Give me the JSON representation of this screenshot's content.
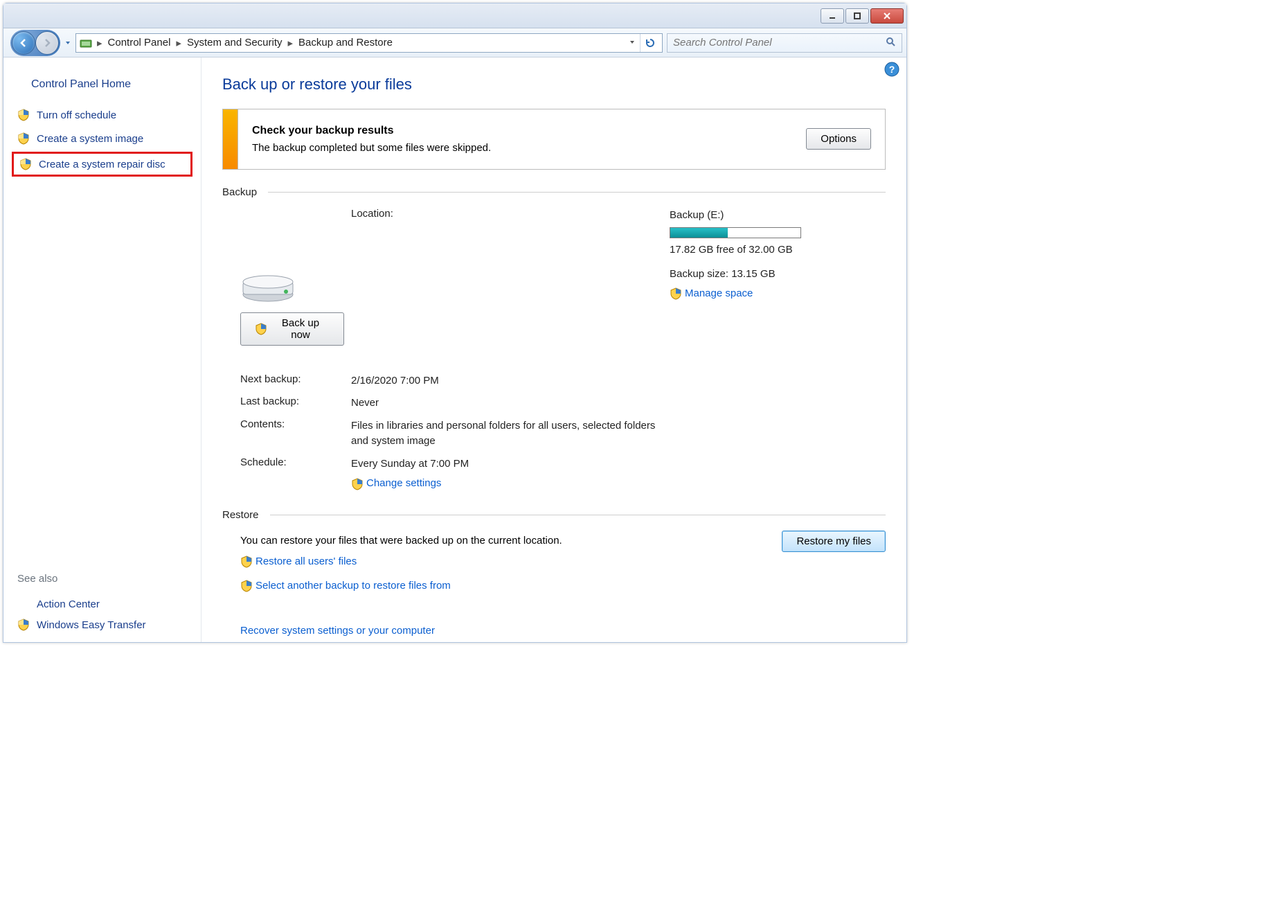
{
  "titlebar": {
    "minimize_label": "Minimize",
    "maximize_label": "Maximize",
    "close_label": "Close"
  },
  "breadcrumbs": {
    "items": [
      "Control Panel",
      "System and Security",
      "Backup and Restore"
    ]
  },
  "search": {
    "placeholder": "Search Control Panel"
  },
  "sidebar": {
    "home": "Control Panel Home",
    "items": [
      {
        "label": "Turn off schedule",
        "highlighted": false
      },
      {
        "label": "Create a system image",
        "highlighted": false
      },
      {
        "label": "Create a system repair disc",
        "highlighted": true
      }
    ],
    "see_also": "See also",
    "bottom_links": [
      {
        "label": "Action Center",
        "shield": false
      },
      {
        "label": "Windows Easy Transfer",
        "shield": true
      }
    ]
  },
  "main": {
    "heading": "Back up or restore your files",
    "alert": {
      "title": "Check your backup results",
      "body": "The backup completed but some files were skipped.",
      "button": "Options"
    },
    "backup": {
      "group_label": "Backup",
      "button": "Back up now",
      "location_label": "Location:",
      "location_value": "Backup (E:)",
      "space_free": "17.82 GB free of 32.00 GB",
      "size": "Backup size: 13.15 GB",
      "manage_link": "Manage space",
      "rows": [
        {
          "label": "Next backup:",
          "value": "2/16/2020 7:00 PM"
        },
        {
          "label": "Last backup:",
          "value": "Never"
        },
        {
          "label": "Contents:",
          "value": "Files in libraries and personal folders for all users, selected folders and system image"
        },
        {
          "label": "Schedule:",
          "value": "Every Sunday at 7:00 PM"
        }
      ],
      "change_link": "Change settings",
      "progress_percent": 44
    },
    "restore": {
      "group_label": "Restore",
      "intro": "You can restore your files that were backed up on the current location.",
      "links": [
        "Restore all users' files",
        "Select another backup to restore files from"
      ],
      "recover_link": "Recover system settings or your computer",
      "button": "Restore my files"
    }
  }
}
